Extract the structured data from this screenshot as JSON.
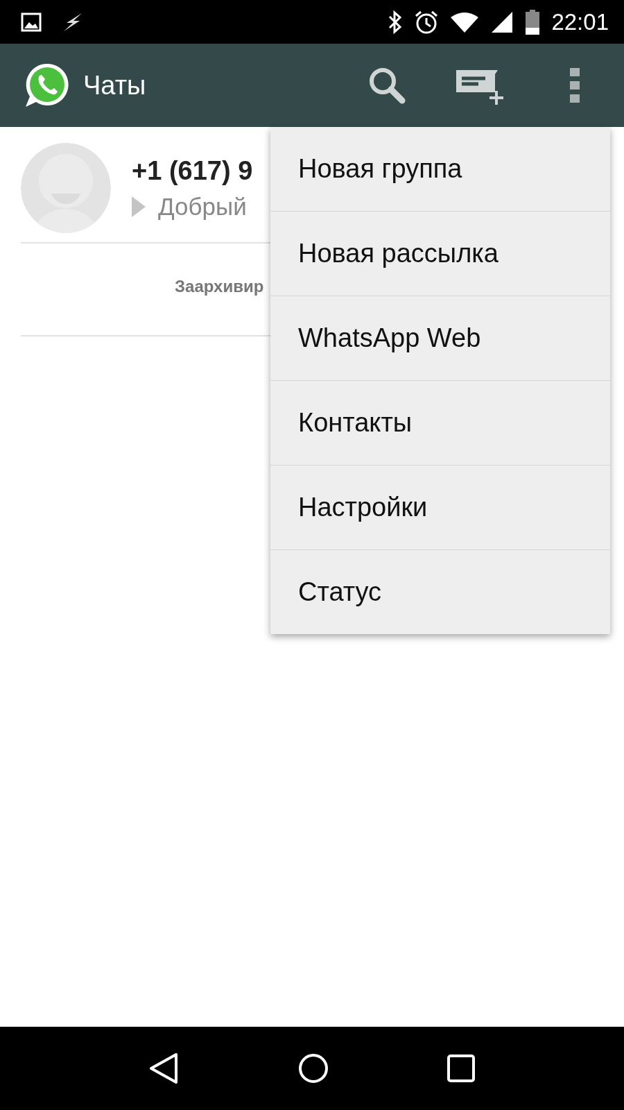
{
  "status_bar": {
    "time": "22:01"
  },
  "app_bar": {
    "title": "Чаты"
  },
  "chats": [
    {
      "name": "+1 (617) 9",
      "preview": "Добрый"
    }
  ],
  "archived": {
    "label": "Заархивир"
  },
  "menu": {
    "items": [
      {
        "label": "Новая группа"
      },
      {
        "label": "Новая рассылка"
      },
      {
        "label": "WhatsApp Web"
      },
      {
        "label": "Контакты"
      },
      {
        "label": "Настройки"
      },
      {
        "label": "Статус"
      }
    ]
  }
}
